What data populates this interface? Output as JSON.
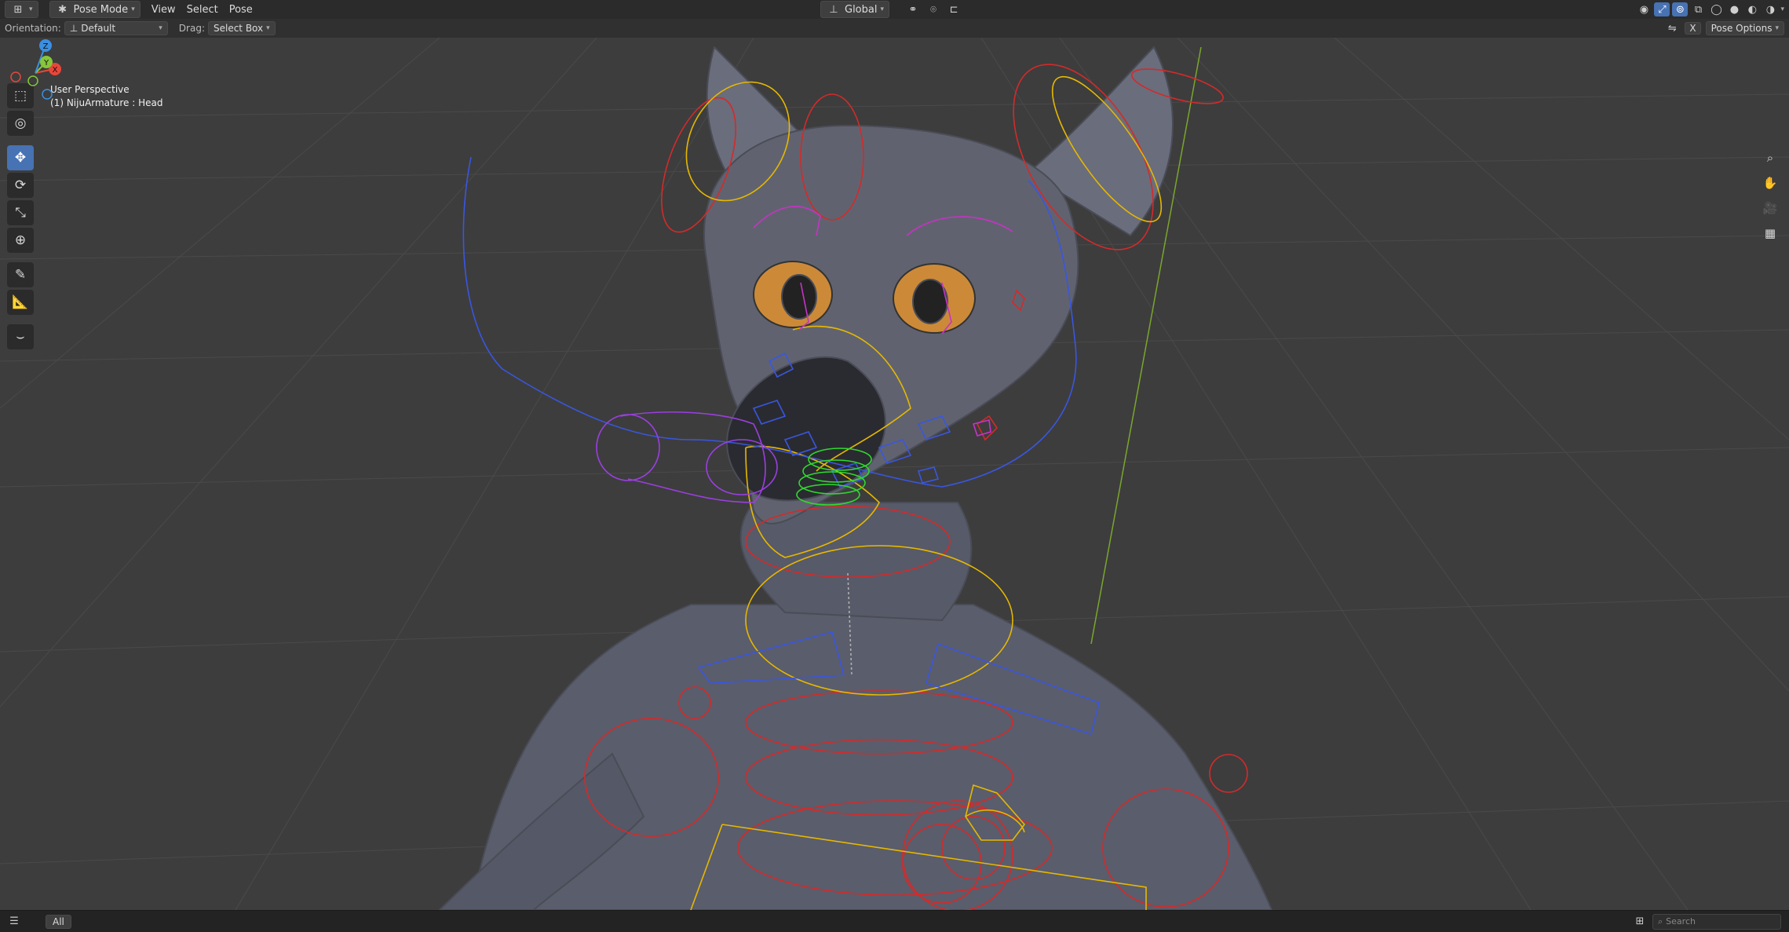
{
  "header": {
    "mode_label": "Pose Mode",
    "menus": [
      "View",
      "Select",
      "Pose"
    ],
    "transform_orientation": "Global"
  },
  "tool_settings": {
    "orientation_label": "Orientation:",
    "orientation_value": "Default",
    "drag_label": "Drag:",
    "drag_value": "Select Box",
    "pose_options": "Pose Options",
    "x_mirror": "X"
  },
  "viewport": {
    "view_name": "User Perspective",
    "object_info": "(1) NijuArmature : Head"
  },
  "gizmo": {
    "x": "X",
    "y": "Y",
    "z": "Z"
  },
  "footer": {
    "tab_label": "All",
    "search_placeholder": "Search"
  },
  "colors": {
    "accent": "#4772b3",
    "bone_red": "#d42a2a",
    "bone_yellow": "#e6b800",
    "bone_blue": "#3a3fd0",
    "bone_green": "#2fd92f",
    "bone_magenta": "#c832c8",
    "axis_x": "#e8463a",
    "axis_y": "#86c63a",
    "axis_z": "#3c8fe0"
  }
}
